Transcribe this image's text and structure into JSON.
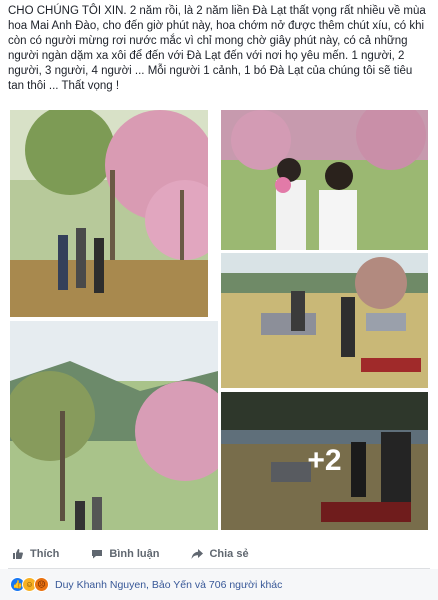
{
  "post": {
    "text": "CHO CHÚNG TÔI XIN. 2 năm rồi, là 2 năm liền Đà Lạt thất vọng rất nhiều về mùa hoa Mai Anh Đào, cho đến giờ phút này, hoa chớm nở được thêm chút xíu, có khi còn có người mừng rơi nước mắc vì chỉ mong chờ giây phút này, có cả những người ngàn dặm xa xôi để đến với Đà Lạt đến với nơi họ yêu mến. 1 người, 2 người, 3 người, 4 người ... Mỗi người 1 cảnh, 1 bó Đà Lạt của chúng tôi sẽ tiêu tan thôi ... Thất vọng !"
  },
  "photos": {
    "more_count": "+2"
  },
  "actions": {
    "like": "Thích",
    "comment": "Bình luận",
    "share": "Chia sẻ"
  },
  "reactions": {
    "summary": "Duy Khanh Nguyen, Bảo Yến và 706 người khác",
    "icons": [
      "like-reaction",
      "haha-reaction",
      "angry-reaction"
    ]
  },
  "colors": {
    "link": "#385898",
    "action_text": "#606770",
    "like_blue": "#1877f2"
  }
}
